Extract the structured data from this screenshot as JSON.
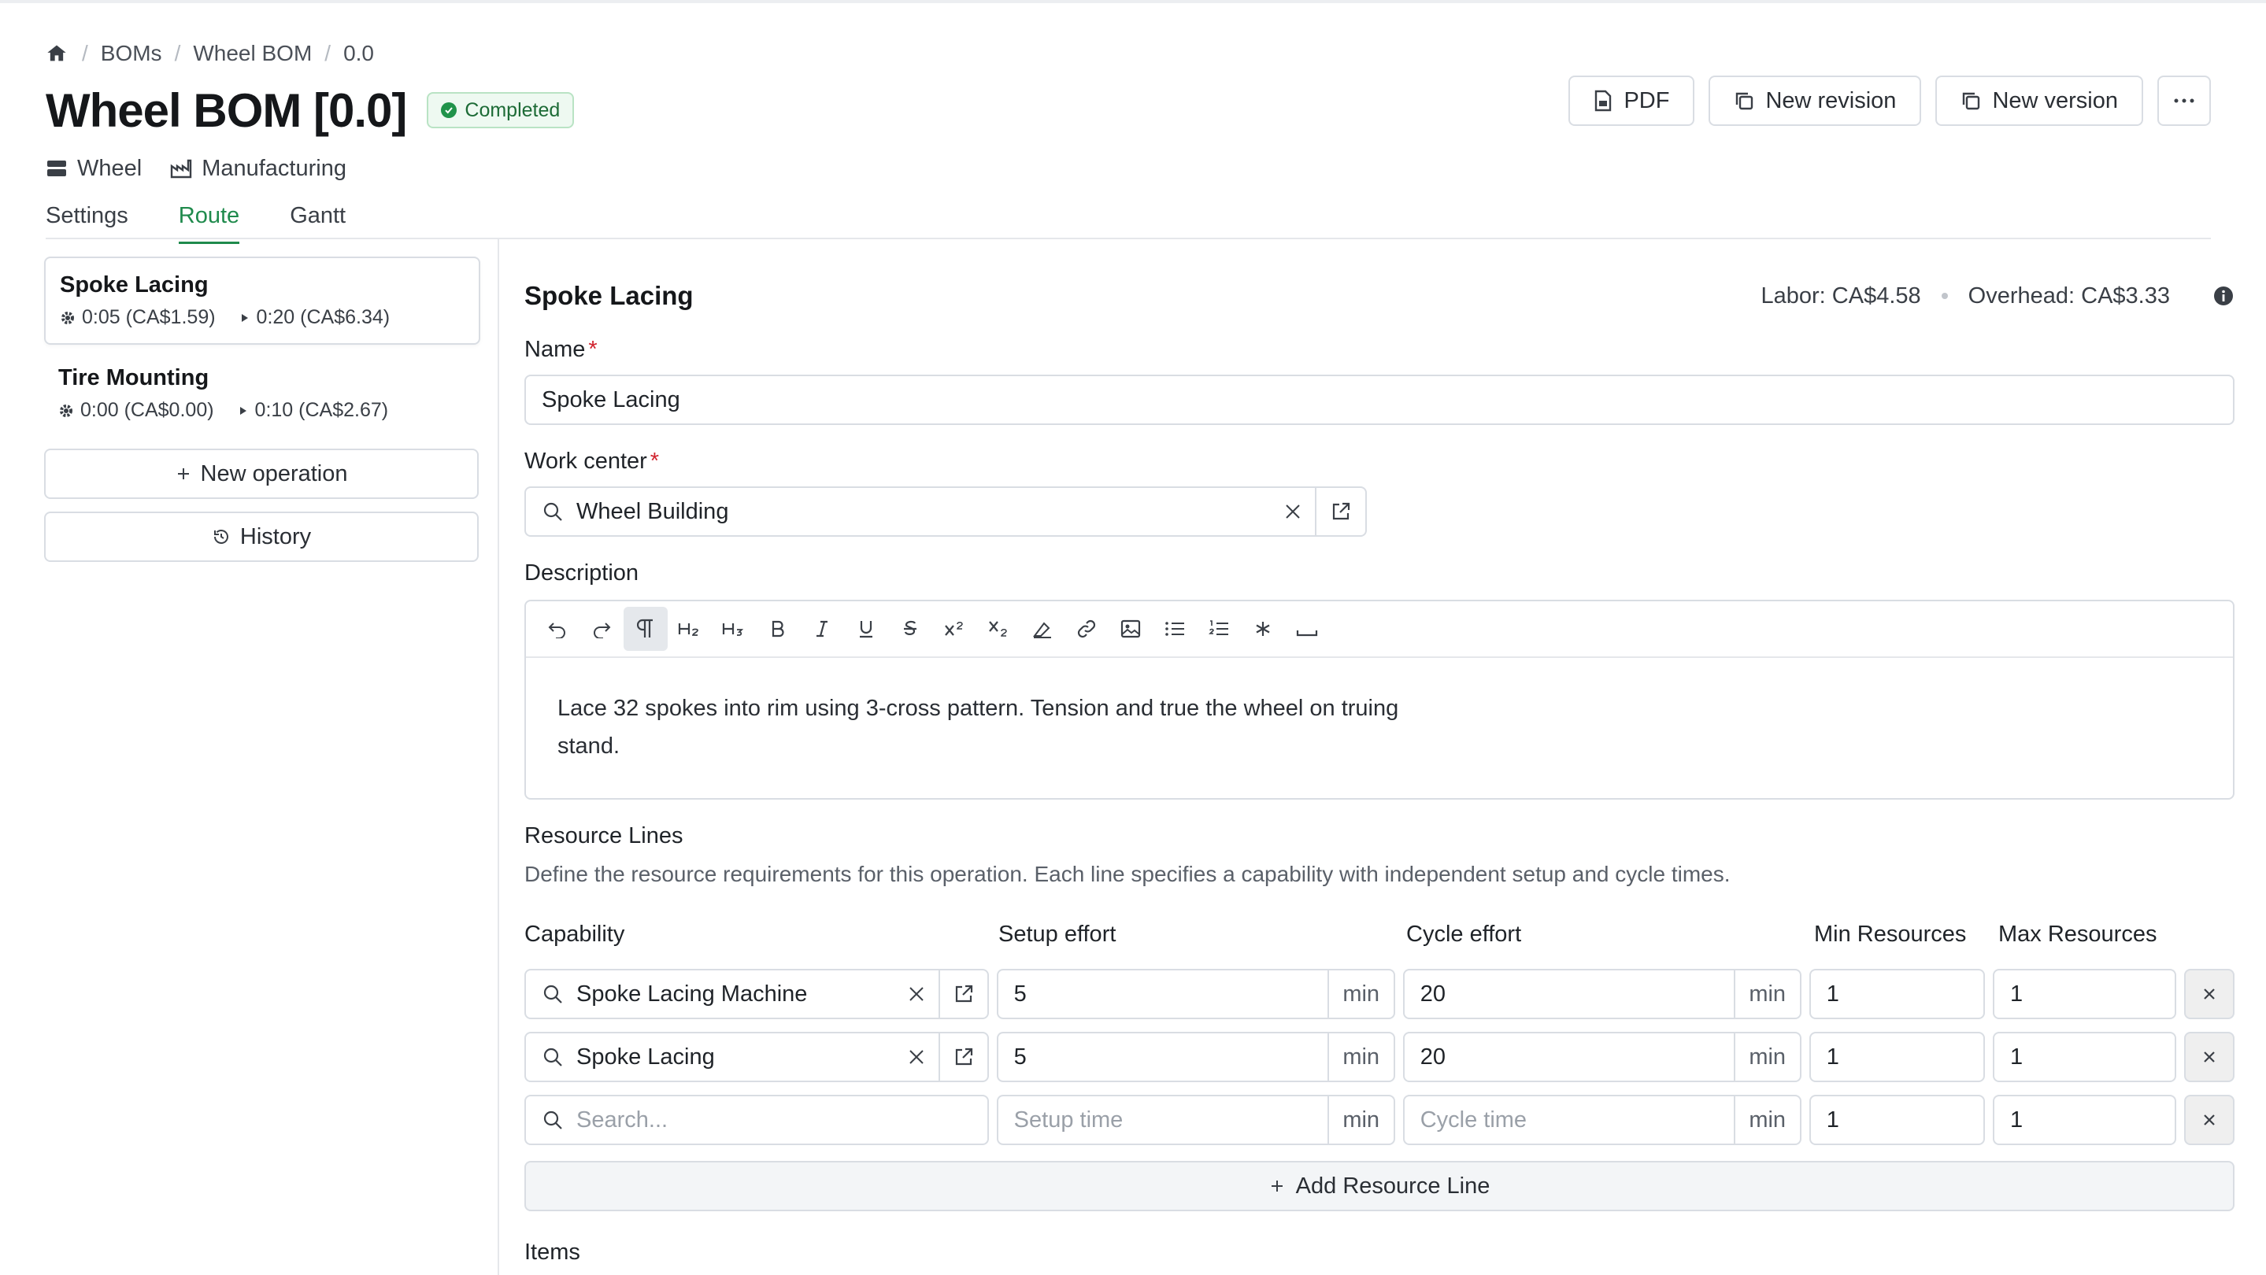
{
  "breadcrumb": {
    "items": [
      "BOMs",
      "Wheel BOM",
      "0.0"
    ]
  },
  "header": {
    "title": "Wheel BOM [0.0]",
    "status": "Completed",
    "meta": {
      "item": "Wheel",
      "type": "Manufacturing"
    },
    "tabs": [
      "Settings",
      "Route",
      "Gantt"
    ],
    "active_tab": "Route",
    "actions": {
      "pdf": "PDF",
      "new_revision": "New revision",
      "new_version": "New version",
      "more": "···"
    }
  },
  "sidebar": {
    "operations": [
      {
        "name": "Spoke Lacing",
        "setup": "0:05 (CA$1.59)",
        "cycle": "0:20 (CA$6.34)"
      },
      {
        "name": "Tire Mounting",
        "setup": "0:00 (CA$0.00)",
        "cycle": "0:10 (CA$2.67)"
      }
    ],
    "new_operation": "New operation",
    "history": "History"
  },
  "operation": {
    "title": "Spoke Lacing",
    "labor": "Labor: CA$4.58",
    "overhead": "Overhead: CA$3.33",
    "name_label": "Name",
    "name_value": "Spoke Lacing",
    "work_center_label": "Work center",
    "work_center_value": "Wheel Building",
    "description_label": "Description",
    "description_text": "Lace 32 spokes into rim using 3-cross pattern. Tension and true the wheel on truing stand."
  },
  "resources": {
    "title": "Resource Lines",
    "description": "Define the resource requirements for this operation. Each line specifies a capability with independent setup and cycle times.",
    "columns": [
      "Capability",
      "Setup effort",
      "Cycle effort",
      "Min Resources",
      "Max Resources"
    ],
    "unit": "min",
    "rows": [
      {
        "capability": "Spoke Lacing Machine",
        "setup": "5",
        "cycle": "20",
        "min": "1",
        "max": "1"
      },
      {
        "capability": "Spoke Lacing",
        "setup": "5",
        "cycle": "20",
        "min": "1",
        "max": "1"
      }
    ],
    "new_row": {
      "capability_placeholder": "Search...",
      "setup_placeholder": "Setup time",
      "cycle_placeholder": "Cycle time",
      "min": "1",
      "max": "1"
    },
    "add_line": "Add Resource Line"
  },
  "items_label": "Items",
  "icons": [
    "home-icon",
    "pdf-icon",
    "copy-icon",
    "more-icon",
    "gear-icon",
    "play-icon",
    "plus-icon",
    "history-icon",
    "search-icon",
    "close-icon",
    "external-link-icon",
    "info-icon"
  ]
}
